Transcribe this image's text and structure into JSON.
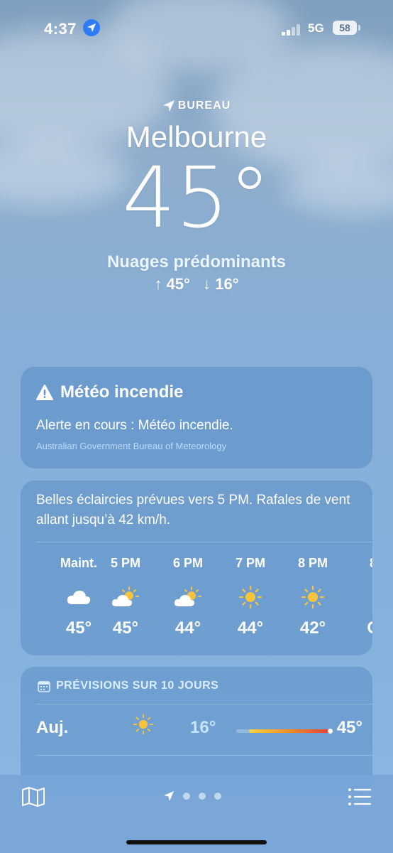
{
  "status_bar": {
    "time": "4:37",
    "network": "5G",
    "battery": "58"
  },
  "header": {
    "location_label": "BUREAU",
    "city": "Melbourne",
    "temperature": "45°",
    "condition": "Nuages prédominants",
    "high": "↑ 45°",
    "low": "↓ 16°"
  },
  "alert": {
    "title": "Météo incendie",
    "text": "Alerte en cours : Météo incendie.",
    "source": "Australian Government Bureau of Meteorology"
  },
  "hourly": {
    "summary": "Belles éclaircies prévues vers 5 PM. Rafales de vent allant jusqu’à 42 km/h.",
    "hours": [
      {
        "label": "Maint.",
        "icon": "cloud-icon",
        "temp": "45°"
      },
      {
        "label": "5 PM",
        "icon": "partly-sunny-icon",
        "temp": "45°"
      },
      {
        "label": "6 PM",
        "icon": "partly-sunny-icon",
        "temp": "44°"
      },
      {
        "label": "7 PM",
        "icon": "sun-icon",
        "temp": "44°"
      },
      {
        "label": "8 PM",
        "icon": "sun-icon",
        "temp": "42°"
      },
      {
        "label": "8",
        "icon": "sun-icon",
        "temp": "C"
      }
    ]
  },
  "forecast": {
    "title": "PRÉVISIONS SUR 10 JOURS",
    "rows": [
      {
        "day": "Auj.",
        "icon": "sun-icon",
        "low": "16°",
        "high": "45°",
        "range_start": 0.13,
        "range_end": 0.98,
        "current": 0.98
      }
    ]
  },
  "colors": {
    "accent_blue": "#2f7cf6",
    "temp_bar_start": "#f5d443",
    "temp_bar_end": "#e0403a",
    "sun": "#f6c43a"
  },
  "bottom_bar": {
    "map_icon": "map-icon",
    "list_icon": "list-icon",
    "pages": 3
  }
}
